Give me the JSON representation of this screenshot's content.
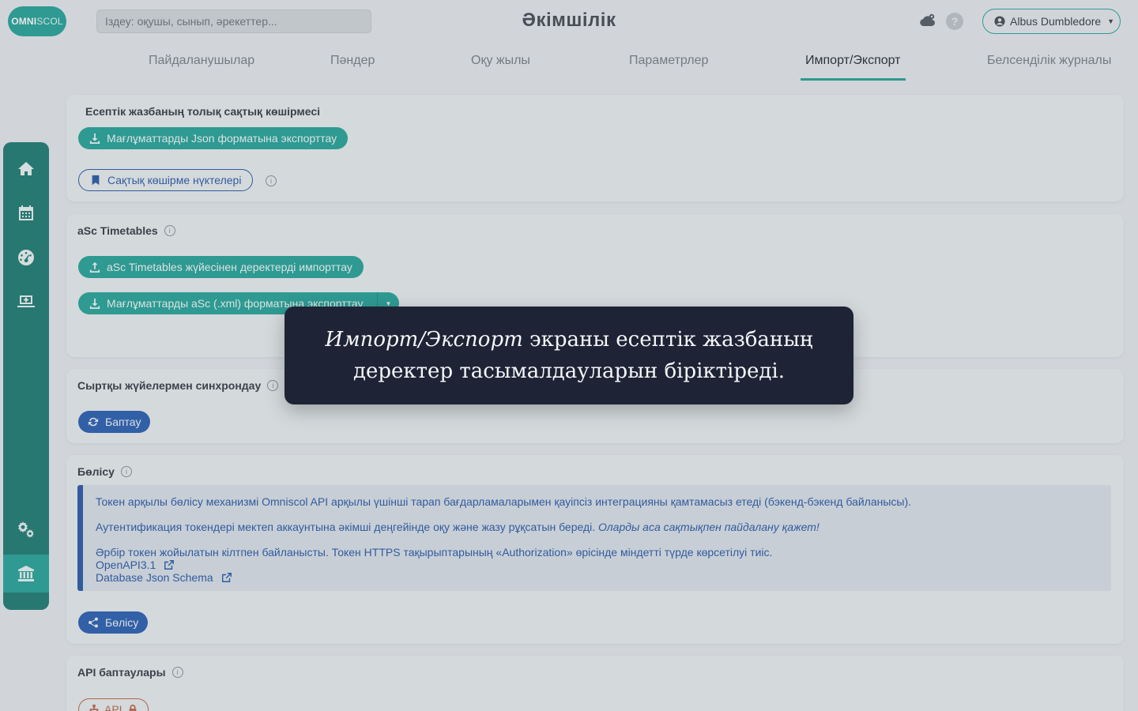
{
  "header": {
    "logo_bold": "OMNI",
    "logo_light": "SCOL",
    "search_placeholder": "Іздеу: оқушы, сынып, әрекеттер...",
    "title": "Әкімшілік",
    "help_glyph": "?",
    "user_name": "Albus Dumbledore",
    "accent_color": "#2aa79b"
  },
  "tabs": [
    {
      "label": "Пайдаланушылар",
      "active": false
    },
    {
      "label": "Пәндер",
      "active": false
    },
    {
      "label": "Оқу жылы",
      "active": false
    },
    {
      "label": "Параметрлер",
      "active": false
    },
    {
      "label": "Импорт/Экспорт",
      "active": true
    },
    {
      "label": "Белсенділік журналы",
      "active": false
    }
  ],
  "rail": {
    "items": [
      "home-icon",
      "calendar-icon",
      "dashboard-icon",
      "laptop-add-icon",
      "gears-icon",
      "institution-icon"
    ],
    "active": "institution-icon"
  },
  "backup": {
    "title": "Есептік жазбаның толық сақтық көшірмесі",
    "export_json_label": "Мағлұматтарды Json форматына экспорттау",
    "restore_points_label": "Сақтық көшірме нүктелері"
  },
  "asc": {
    "title": "aSc Timetables",
    "import_label": "aSc Timetables жүйесінен деректерді импорттау",
    "export_xml_label": "Мағлұматтарды aSc (.xml) форматына экспорттау"
  },
  "sync": {
    "title": "Сыртқы жүйелермен синхрондау",
    "settings_label": "Баптау"
  },
  "sharing": {
    "title": "Бөлісу",
    "line1": "Токен арқылы бөлісу механизмі Omniscol API арқылы үшінші тарап бағдарламаларымен қауіпсіз интеграцияны қамтамасыз етеді (бэкенд-бэкенд байланысы).",
    "line2_plain": "Аутентификация токендері мектеп аккаунтына әкімші деңгейінде оқу және жазу рұқсатын береді.",
    "line2_emphasis": "Оларды аса сақтықпен пайдалану қажет!",
    "line3": "Әрбір токен жойылатын кілтпен байланысты. Токен HTTPS тақырыптарының «Authorization» өрісінде міндетті түрде көрсетілуі тиіс.",
    "link_openapi": "OpenAPI3.1",
    "link_schema": "Database Json Schema",
    "share_label": "Бөлісу"
  },
  "api": {
    "title": "API баптаулары",
    "api_label": "API"
  },
  "tooltip": {
    "emphasis": "Импорт/Экспорт",
    "line1_rest": " экраны есептік жазбаның",
    "line2": "деректер тасымалдауларын біріктіреді."
  }
}
